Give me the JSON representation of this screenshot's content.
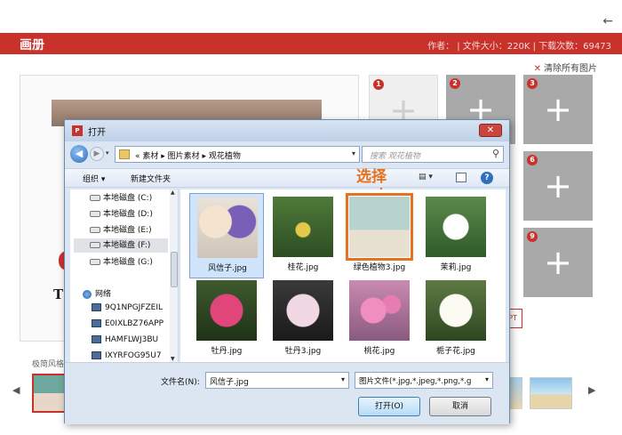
{
  "app": {
    "title": "画册",
    "meta": "作者： | 文件大小：220K | 下载次数：69473",
    "back_icon": "←",
    "clear_all": "清除所有图片",
    "ppt_tag": "PT",
    "canvas_text": "T",
    "style_label": "极简风格"
  },
  "slots": [
    {
      "num": "1",
      "tone": "light"
    },
    {
      "num": "2",
      "tone": "dark"
    },
    {
      "num": "3",
      "tone": "dark"
    },
    {
      "num": "6",
      "tone": "dark"
    },
    {
      "num": "9",
      "tone": "dark"
    }
  ],
  "dialog": {
    "title": "打开",
    "icon_text": "P",
    "close": "✕",
    "address_path": "« 素材 ▸ 图片素材 ▸ 观花植物",
    "search_placeholder": "搜索 观花植物",
    "organize": "组织 ▾",
    "new_folder": "新建文件夹",
    "select_callout": "选择",
    "tree": {
      "drives": [
        "本地磁盘 (C:)",
        "本地磁盘 (D:)",
        "本地磁盘 (E:)",
        "本地磁盘 (F:)",
        "本地磁盘 (G:)"
      ],
      "selected_drive_index": 3,
      "network": "网络",
      "computers": [
        "9Q1NPGJFZEIL",
        "E0IXLBZ76APP",
        "HAMFLWJ3BU",
        "IXYRFOG95U7"
      ]
    },
    "files": [
      {
        "name": "风信子.jpg",
        "selected": true
      },
      {
        "name": "桂花.jpg"
      },
      {
        "name": "绿色植物3.jpg",
        "highlighted": true
      },
      {
        "name": "茉莉.jpg"
      },
      {
        "name": "牡丹.jpg"
      },
      {
        "name": "牡丹3.jpg"
      },
      {
        "name": "桃花.jpg"
      },
      {
        "name": "栀子花.jpg"
      }
    ],
    "filename_label": "文件名(N):",
    "filename_value": "风信子.jpg",
    "filetype_value": "图片文件(*.jpg,*.jpeg,*.png,*.g",
    "open_button": "打开(O)",
    "cancel_button": "取消"
  },
  "colors": {
    "brand_red": "#c9322b",
    "callout_orange": "#e8711f"
  }
}
